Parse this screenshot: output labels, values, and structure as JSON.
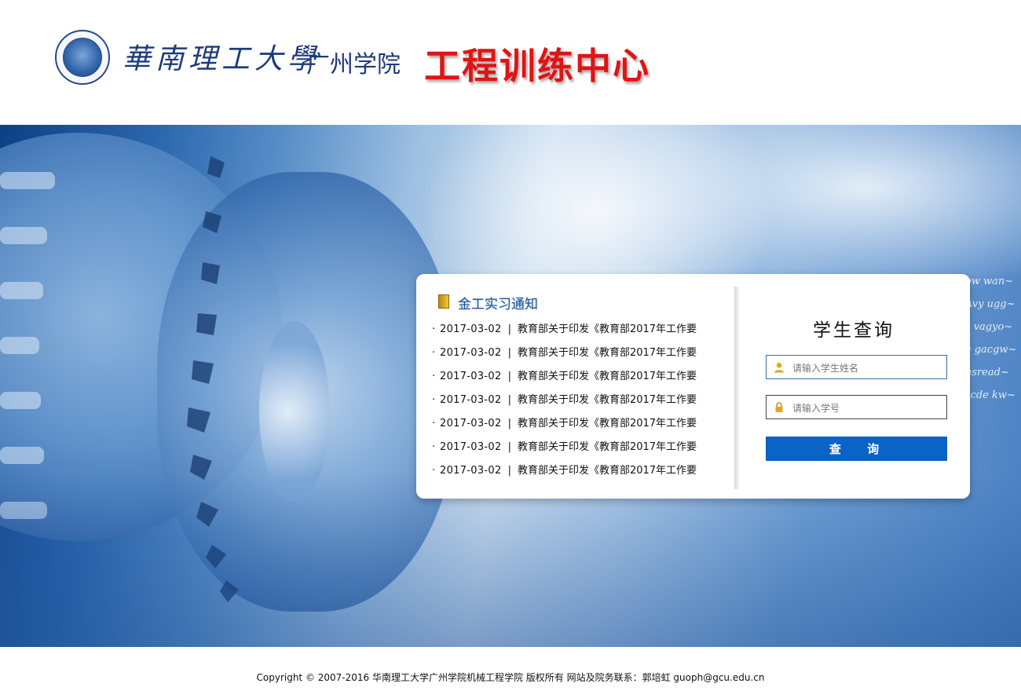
{
  "header": {
    "university_name": "華南理工大學",
    "campus_name": "广州学院",
    "center_title": "工程训练中心"
  },
  "notices": {
    "title": "金工实习通知",
    "items": [
      {
        "bullet": "·",
        "date": "2017-03-02",
        "separator": "|",
        "title": "教育部关于印发《教育部2017年工作要"
      },
      {
        "bullet": "·",
        "date": "2017-03-02",
        "separator": "|",
        "title": "教育部关于印发《教育部2017年工作要"
      },
      {
        "bullet": "·",
        "date": "2017-03-02",
        "separator": "|",
        "title": "教育部关于印发《教育部2017年工作要"
      },
      {
        "bullet": "·",
        "date": "2017-03-02",
        "separator": "|",
        "title": "教育部关于印发《教育部2017年工作要"
      },
      {
        "bullet": "·",
        "date": "2017-03-02",
        "separator": "|",
        "title": "教育部关于印发《教育部2017年工作要"
      },
      {
        "bullet": "·",
        "date": "2017-03-02",
        "separator": "|",
        "title": "教育部关于印发《教育部2017年工作要"
      },
      {
        "bullet": "·",
        "date": "2017-03-02",
        "separator": "|",
        "title": "教育部关于印发《教育部2017年工作要"
      }
    ]
  },
  "query": {
    "title": "学生查询",
    "name_placeholder": "请输入学生姓名",
    "id_placeholder": "请输入学号",
    "button_label": "查 询"
  },
  "footer": {
    "copyright": "Copyright © 2007-2016 华南理工大学广州学院机械工程学院 版权所有 网站及院务联系：郭培虹 guoph@gcu.edu.cn"
  },
  "icons": {
    "user_icon": "user-icon",
    "lock_icon": "lock-icon",
    "notice_icon": "notebook-icon"
  },
  "colors": {
    "title_red": "#e01414",
    "brand_blue": "#1e3a7a",
    "button_blue": "#0a63c6"
  }
}
